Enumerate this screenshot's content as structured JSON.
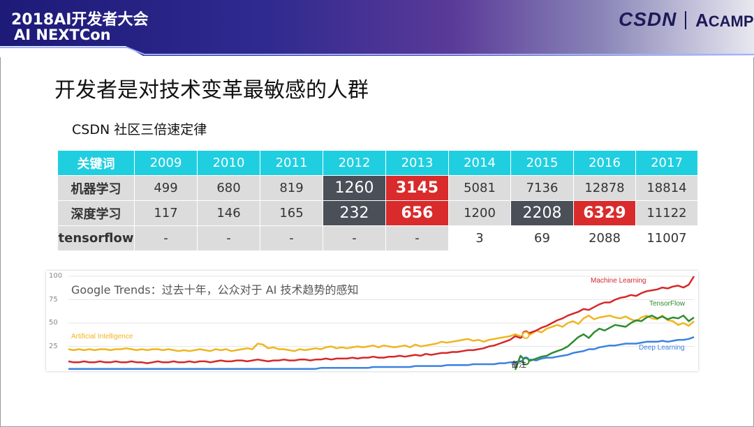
{
  "header": {
    "conf_title": "2018AI开发者大会",
    "conf_name": "AI NEXTCon",
    "logo_csdn": "CSDN",
    "logo_camp": "CAMP",
    "logo_camp_initial": "A"
  },
  "slide": {
    "title": "开发者是对技术变革最敏感的人群",
    "subtitle": "CSDN 社区三倍速定律"
  },
  "table": {
    "headers": [
      "关键词",
      "2009",
      "2010",
      "2011",
      "2012",
      "2013",
      "2014",
      "2015",
      "2016",
      "2017"
    ],
    "rows": [
      [
        "机器学习",
        "499",
        "680",
        "819",
        "1260",
        "3145",
        "5081",
        "7136",
        "12878",
        "18814"
      ],
      [
        "深度学习",
        "117",
        "146",
        "165",
        "232",
        "656",
        "1200",
        "2208",
        "6329",
        "11122"
      ],
      [
        "tensorflow",
        "-",
        "-",
        "-",
        "-",
        "-",
        "3",
        "69",
        "2088",
        "11007"
      ]
    ]
  },
  "chart_data": {
    "type": "line",
    "title": "Google Trends：过去十年，公众对于 AI 技术趋势的感知",
    "ylim": [
      0,
      100
    ],
    "yticks": [
      "100",
      "75",
      "50",
      "25"
    ],
    "annotation": "备注",
    "x": [
      0,
      1,
      2,
      3,
      4,
      5,
      6,
      7,
      8,
      9,
      10,
      11,
      12,
      13,
      14,
      15,
      16,
      17,
      18,
      19,
      20,
      21,
      22,
      23,
      24,
      25,
      26,
      27,
      28,
      29,
      30,
      31,
      32,
      33,
      34,
      35,
      36,
      37,
      38,
      39,
      40,
      41,
      42,
      43,
      44,
      45,
      46,
      47,
      48,
      49,
      50,
      51,
      52,
      53,
      54,
      55,
      56,
      57,
      58,
      59,
      60,
      61,
      62,
      63,
      64,
      65,
      66,
      67,
      68,
      69,
      70,
      71,
      72,
      73,
      74,
      75,
      76,
      77,
      78,
      79,
      80,
      81,
      82,
      83,
      84,
      85,
      86,
      87,
      88,
      89,
      90,
      91,
      92,
      93,
      94,
      95,
      96,
      97,
      98,
      99,
      100,
      101,
      102,
      103,
      104,
      105,
      106,
      107,
      108,
      109,
      110,
      111,
      112,
      113,
      114,
      115,
      116,
      117,
      118,
      119
    ],
    "series": [
      {
        "name": "Machine Learning",
        "color": "#d62728",
        "label_pos": "top-right",
        "values": [
          9,
          8,
          8,
          9,
          8,
          8,
          9,
          8,
          8,
          9,
          8,
          8,
          9,
          8,
          8,
          7,
          8,
          9,
          8,
          8,
          9,
          8,
          8,
          9,
          8,
          9,
          9,
          8,
          9,
          10,
          9,
          9,
          10,
          10,
          9,
          10,
          11,
          10,
          9,
          10,
          10,
          11,
          10,
          10,
          11,
          11,
          10,
          11,
          11,
          12,
          11,
          12,
          12,
          12,
          13,
          12,
          13,
          13,
          14,
          13,
          13,
          14,
          14,
          15,
          14,
          15,
          16,
          15,
          17,
          16,
          17,
          18,
          18,
          19,
          19,
          20,
          21,
          21,
          22,
          23,
          25,
          26,
          28,
          30,
          32,
          36,
          34,
          38,
          40,
          42,
          45,
          47,
          50,
          53,
          55,
          58,
          60,
          62,
          65,
          64,
          67,
          70,
          72,
          72,
          75,
          77,
          78,
          80,
          79,
          82,
          84,
          85,
          86,
          88,
          87,
          89,
          90,
          88,
          91,
          100
        ]
      },
      {
        "name": "Artificial Intelligence",
        "color": "#f0b51e",
        "label_pos": "left",
        "values": [
          22,
          21,
          22,
          21,
          22,
          21,
          22,
          22,
          21,
          22,
          22,
          23,
          22,
          21,
          22,
          21,
          22,
          22,
          21,
          22,
          21,
          20,
          21,
          20,
          21,
          22,
          21,
          20,
          22,
          21,
          22,
          20,
          21,
          22,
          23,
          22,
          28,
          27,
          23,
          24,
          22,
          22,
          21,
          20,
          22,
          21,
          22,
          23,
          22,
          24,
          25,
          23,
          24,
          23,
          24,
          25,
          24,
          25,
          26,
          24,
          26,
          25,
          24,
          25,
          26,
          24,
          27,
          25,
          26,
          27,
          28,
          30,
          29,
          30,
          31,
          32,
          33,
          31,
          32,
          30,
          32,
          33,
          34,
          35,
          36,
          38,
          36,
          37,
          38,
          42,
          40,
          44,
          46,
          48,
          46,
          50,
          52,
          49,
          55,
          58,
          54,
          56,
          57,
          58,
          56,
          55,
          57,
          54,
          52,
          56,
          58,
          55,
          54,
          58,
          53,
          52,
          48,
          50,
          47,
          52
        ]
      },
      {
        "name": "TensorFlow",
        "color": "#2e8b2e",
        "label_pos": "right",
        "values": [
          null,
          null,
          null,
          null,
          null,
          null,
          null,
          null,
          null,
          null,
          null,
          null,
          null,
          null,
          null,
          null,
          null,
          null,
          null,
          null,
          null,
          null,
          null,
          null,
          null,
          null,
          null,
          null,
          null,
          null,
          null,
          null,
          null,
          null,
          null,
          null,
          null,
          null,
          null,
          null,
          null,
          null,
          null,
          null,
          null,
          null,
          null,
          null,
          null,
          null,
          null,
          null,
          null,
          null,
          null,
          null,
          null,
          null,
          null,
          null,
          null,
          null,
          null,
          null,
          null,
          null,
          null,
          null,
          null,
          null,
          null,
          null,
          null,
          null,
          null,
          null,
          null,
          null,
          null,
          null,
          null,
          null,
          null,
          null,
          null,
          0,
          15,
          9,
          10,
          12,
          14,
          15,
          18,
          20,
          22,
          25,
          30,
          35,
          38,
          34,
          40,
          44,
          42,
          45,
          48,
          47,
          46,
          50,
          53,
          52,
          56,
          58,
          55,
          57,
          54,
          56,
          55,
          58,
          52,
          56
        ]
      },
      {
        "name": "Deep Learning",
        "color": "#3b82e0",
        "label_pos": "right",
        "values": [
          1,
          1,
          1,
          1,
          1,
          1,
          1,
          1,
          1,
          1,
          1,
          1,
          1,
          1,
          1,
          1,
          1,
          1,
          1,
          1,
          1,
          1,
          1,
          1,
          1,
          1,
          1,
          1,
          1,
          1,
          1,
          1,
          1,
          1,
          1,
          1,
          1,
          1,
          1,
          1,
          1,
          1,
          1,
          1,
          1,
          1,
          1,
          1,
          2,
          2,
          2,
          2,
          2,
          2,
          2,
          2,
          2,
          2,
          3,
          3,
          3,
          3,
          3,
          3,
          3,
          3,
          4,
          4,
          4,
          4,
          4,
          4,
          5,
          5,
          5,
          5,
          5,
          6,
          6,
          6,
          6,
          6,
          7,
          7,
          8,
          8,
          9,
          10,
          11,
          10,
          12,
          13,
          13,
          14,
          15,
          16,
          18,
          19,
          20,
          22,
          22,
          24,
          25,
          26,
          26,
          27,
          28,
          28,
          28,
          29,
          30,
          30,
          30,
          31,
          30,
          31,
          32,
          32,
          33,
          35
        ]
      }
    ]
  }
}
